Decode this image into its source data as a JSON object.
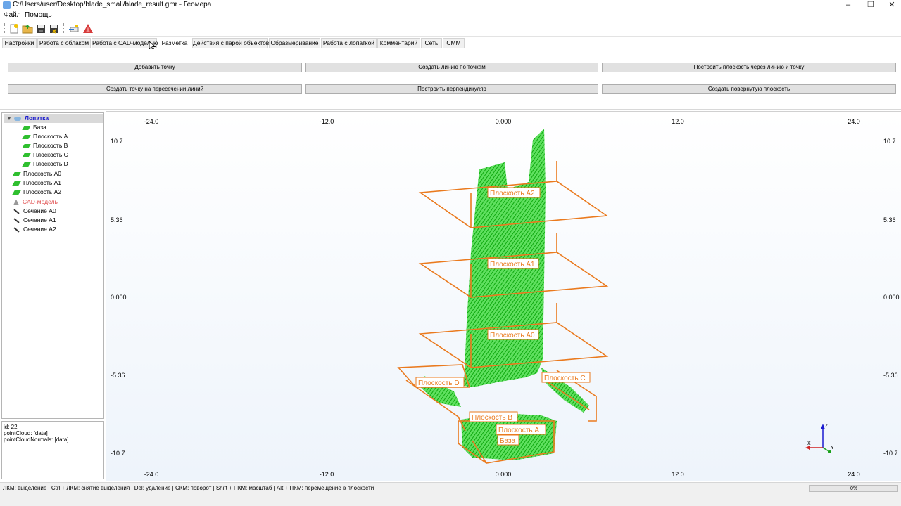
{
  "window": {
    "title": "C:/Users/user/Desktop/blade_small/blade_result.gmr - Геомера",
    "controls": {
      "minimize_icon": "minimize-icon",
      "restore_icon": "restore-icon",
      "close_icon": "close-icon"
    }
  },
  "menu": {
    "file": "Файл",
    "help": "Помощь"
  },
  "toolbar": {
    "icons": [
      "new-file-icon",
      "open-folder-icon",
      "save-icon",
      "save-as-icon",
      "load-icon",
      "cad-import-icon"
    ]
  },
  "tabs": [
    "Настройки",
    "Работа с облаком",
    "Работа с CAD-моделью",
    "Разметка",
    "Действия с парой объектов",
    "Образмеривание",
    "Работа с лопаткой",
    "Комментарий",
    "Сеть",
    "СММ"
  ],
  "active_tab": "Разметка",
  "commands": {
    "add_point": "Добавить точку",
    "create_line_by_points": "Создать линию по точкам",
    "plane_by_line_and_point": "Построить плоскость через линию и точку",
    "point_at_line_intersection": "Создать точку на пересечении линий",
    "build_perpendicular": "Построить перпендикуляр",
    "create_rotated_plane": "Создать повернутую плоскость"
  },
  "tree": [
    {
      "label": "Лопатка",
      "icon": "point-cloud-icon",
      "selected": true,
      "color": "#1a1acc"
    },
    {
      "label": "База",
      "icon": "plane-icon"
    },
    {
      "label": "Плоскость A",
      "icon": "plane-icon"
    },
    {
      "label": "Плоскость B",
      "icon": "plane-icon"
    },
    {
      "label": "Плоскость C",
      "icon": "plane-icon"
    },
    {
      "label": "Плоскость D",
      "icon": "plane-icon"
    },
    {
      "label": "Плоскость A0",
      "icon": "plane-icon"
    },
    {
      "label": "Плоскость A1",
      "icon": "plane-icon"
    },
    {
      "label": "Плоскость A2",
      "icon": "plane-icon"
    },
    {
      "label": "CAD-модель",
      "icon": "cad-model-icon",
      "color": "#e05050"
    },
    {
      "label": "Сечение A0",
      "icon": "section-icon"
    },
    {
      "label": "Сечение A1",
      "icon": "section-icon"
    },
    {
      "label": "Сечение A2",
      "icon": "section-icon"
    }
  ],
  "properties": {
    "line1": "id: 22",
    "line2": "pointCloud: [data]",
    "line3": "pointCloudNormals: [data]"
  },
  "viewport": {
    "x_ticks": [
      "-24.0",
      "-12.0",
      "0.000",
      "12.0",
      "24.0"
    ],
    "y_ticks": [
      "10.7",
      "5.36",
      "0.000",
      "-5.36",
      "-10.7"
    ],
    "plane_labels": [
      "Плоскость A2",
      "Плоскость A1",
      "Плоскость A0",
      "Плоскость D",
      "Плоскость C",
      "Плоскость B",
      "Плоскость A",
      "База"
    ],
    "axis_labels": {
      "z": "Z",
      "x": "X",
      "y": "Y"
    },
    "colors": {
      "cloud": "#19c219",
      "plane": "#ea7a1e",
      "background": "#eef4fb"
    }
  },
  "status": {
    "hints": "ЛКМ: выделение | Ctrl + ЛКМ: снятие выделения | Del: удаление | СКМ: поворот | Shift + ПКМ: масштаб | Alt + ПКМ: перемещение в плоскости",
    "progress_text": "0%",
    "progress_value": 0
  }
}
